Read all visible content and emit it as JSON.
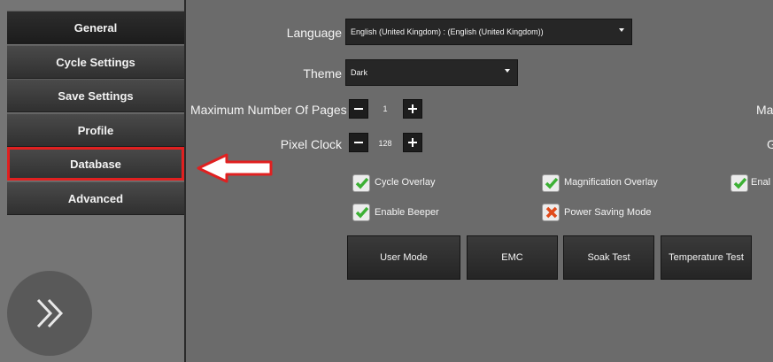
{
  "sidebar": {
    "items": [
      {
        "label": "General"
      },
      {
        "label": "Cycle Settings"
      },
      {
        "label": "Save Settings"
      },
      {
        "label": "Profile"
      },
      {
        "label": "Database"
      },
      {
        "label": "Advanced"
      }
    ],
    "expand_icon": "double-chevron-right-icon"
  },
  "settings": {
    "language": {
      "label": "Language",
      "value": "English (United Kingdom) :  (English (United Kingdom))"
    },
    "theme": {
      "label": "Theme",
      "value": "Dark"
    },
    "max_pages": {
      "label": "Maximum Number Of Pages",
      "value": "1"
    },
    "pixel_clock": {
      "label": "Pixel Clock",
      "value": "128"
    },
    "right_clipped": {
      "row3": "Ma",
      "row4": "G",
      "check": "Enal"
    }
  },
  "checkboxes": [
    {
      "label": "Cycle Overlay",
      "checked": true
    },
    {
      "label": "Magnification Overlay",
      "checked": true
    },
    {
      "label": "Enable Beeper",
      "checked": true
    },
    {
      "label": "Power Saving Mode",
      "checked": false
    }
  ],
  "buttons": {
    "user_mode": "User Mode",
    "emc": "EMC",
    "soak_test": "Soak Test",
    "temperature_test": "Temperature Test"
  },
  "colors": {
    "annotation": "#e02020",
    "check_green": "#3cb034",
    "cross_red": "#e04a1a"
  }
}
